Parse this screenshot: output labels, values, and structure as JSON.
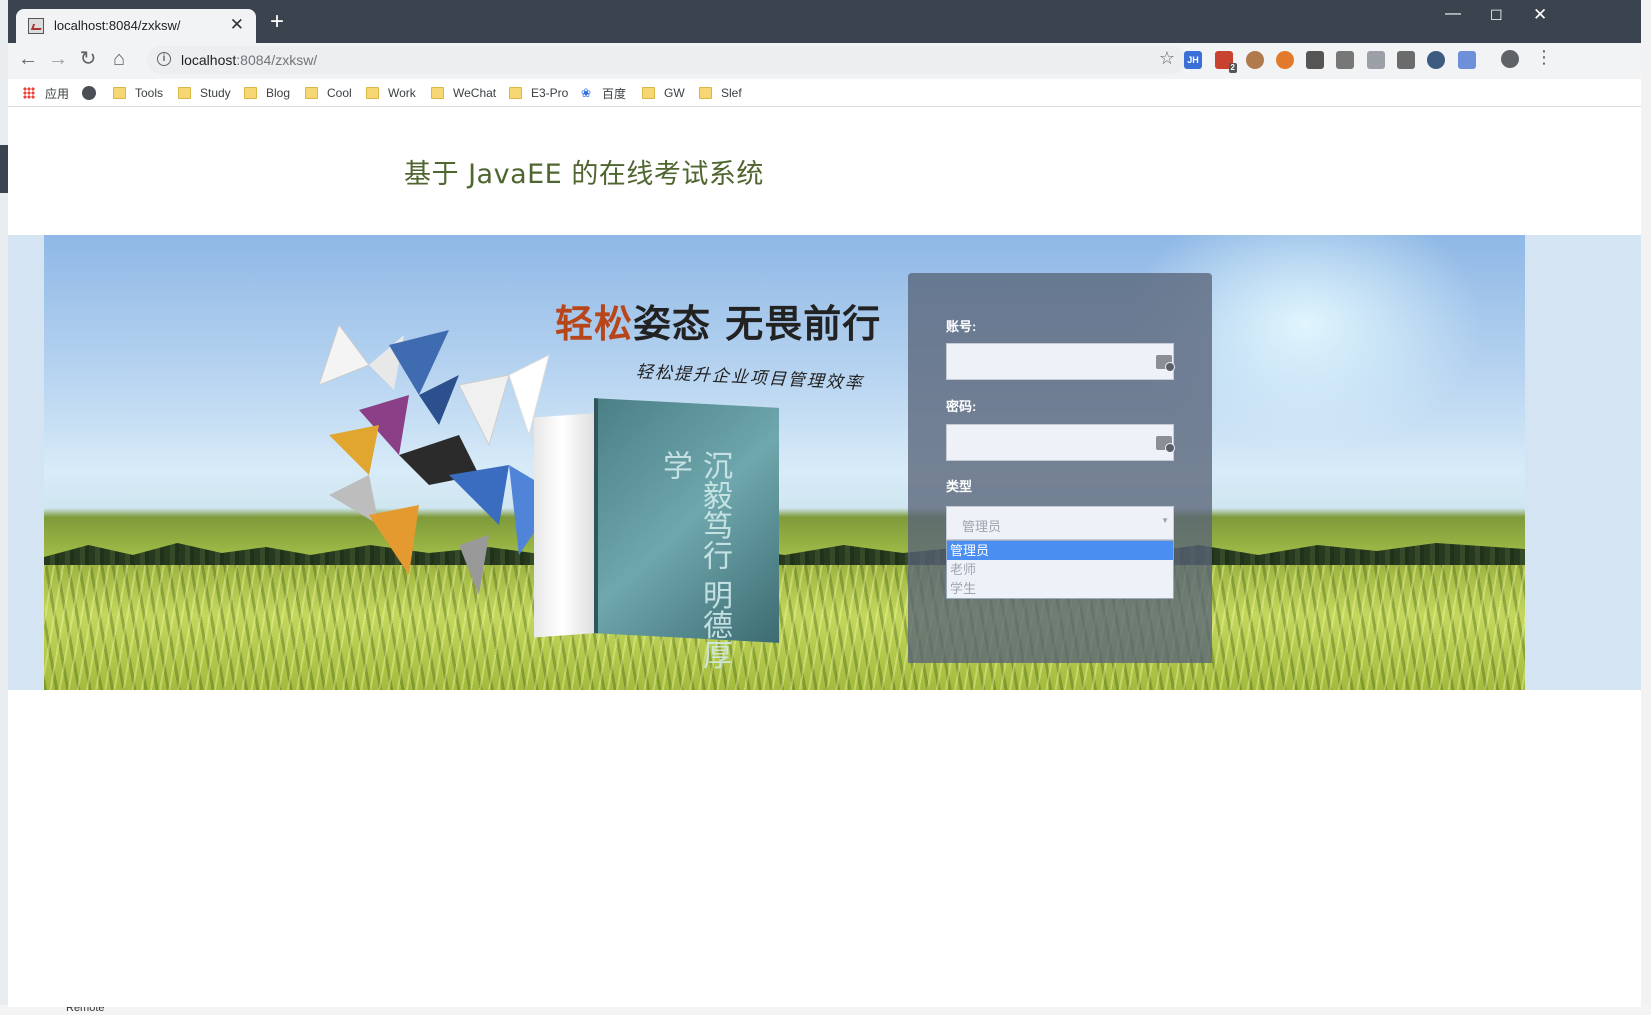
{
  "browser": {
    "tab_title": "localhost:8084/zxksw/",
    "url_host": "localhost",
    "url_rest": ":8084/zxksw/",
    "bookmarks": [
      {
        "label": "应用"
      },
      {
        "label": "Tools"
      },
      {
        "label": "Study"
      },
      {
        "label": "Blog"
      },
      {
        "label": "Cool"
      },
      {
        "label": "Work"
      },
      {
        "label": "WeChat"
      },
      {
        "label": "E3-Pro"
      },
      {
        "label": "百度"
      },
      {
        "label": "GW"
      },
      {
        "label": "Slef"
      }
    ],
    "extensions": [
      "JH",
      "2"
    ]
  },
  "page": {
    "title": "基于 JavaEE 的在线考试系统",
    "slogan_highlight": "轻松",
    "slogan_rest": "姿态 无畏前行",
    "subslogan": "轻松提升企业项目管理效率",
    "book_text": "沉毅笃行 明德厚学"
  },
  "login": {
    "account_label": "账号:",
    "account_value": "",
    "password_label": "密码:",
    "password_value": "",
    "type_label": "类型",
    "type_selected": "管理员",
    "type_options": [
      {
        "label": "管理员",
        "selected": true
      },
      {
        "label": "老师",
        "selected": false
      },
      {
        "label": "学生",
        "selected": false
      }
    ]
  },
  "desktop": {
    "bottom_item": "Remote"
  }
}
